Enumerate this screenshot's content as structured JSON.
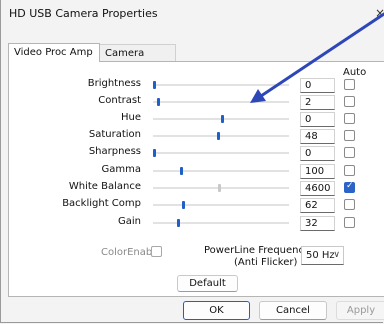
{
  "window": {
    "title": "HD USB Camera Properties",
    "close_glyph": "×"
  },
  "tabs": [
    {
      "label": "Video Proc Amp",
      "active": true
    },
    {
      "label": "Camera Control",
      "active": false
    }
  ],
  "auto_header": "Auto",
  "properties": [
    {
      "label": "Brightness",
      "value": "0",
      "level": 0.0,
      "auto": false,
      "enabled": true
    },
    {
      "label": "Contrast",
      "value": "2",
      "level": 0.03,
      "auto": false,
      "enabled": true
    },
    {
      "label": "Hue",
      "value": "0",
      "level": 0.5,
      "auto": false,
      "enabled": true
    },
    {
      "label": "Saturation",
      "value": "48",
      "level": 0.47,
      "auto": false,
      "enabled": true
    },
    {
      "label": "Sharpness",
      "value": "0",
      "level": 0.0,
      "auto": false,
      "enabled": true
    },
    {
      "label": "Gamma",
      "value": "100",
      "level": 0.2,
      "auto": false,
      "enabled": true
    },
    {
      "label": "White Balance",
      "value": "4600",
      "level": 0.48,
      "auto": true,
      "enabled": false
    },
    {
      "label": "Backlight Comp",
      "value": "62",
      "level": 0.21,
      "auto": false,
      "enabled": true
    },
    {
      "label": "Gain",
      "value": "32",
      "level": 0.18,
      "auto": false,
      "enabled": true
    }
  ],
  "color_enable": {
    "label": "ColorEnable",
    "checked": false
  },
  "powerline": {
    "label_line1": "PowerLine Frequency",
    "label_line2": "(Anti Flicker)",
    "value": "50 Hz"
  },
  "buttons": {
    "default": "Default",
    "ok": "OK",
    "cancel": "Cancel",
    "apply": "Apply"
  },
  "annotation": {
    "color": "#2e47b8",
    "shape": "arrow"
  },
  "colors": {
    "accent": "#1f5fc8",
    "checkbox_checked": "#2b63c6"
  }
}
